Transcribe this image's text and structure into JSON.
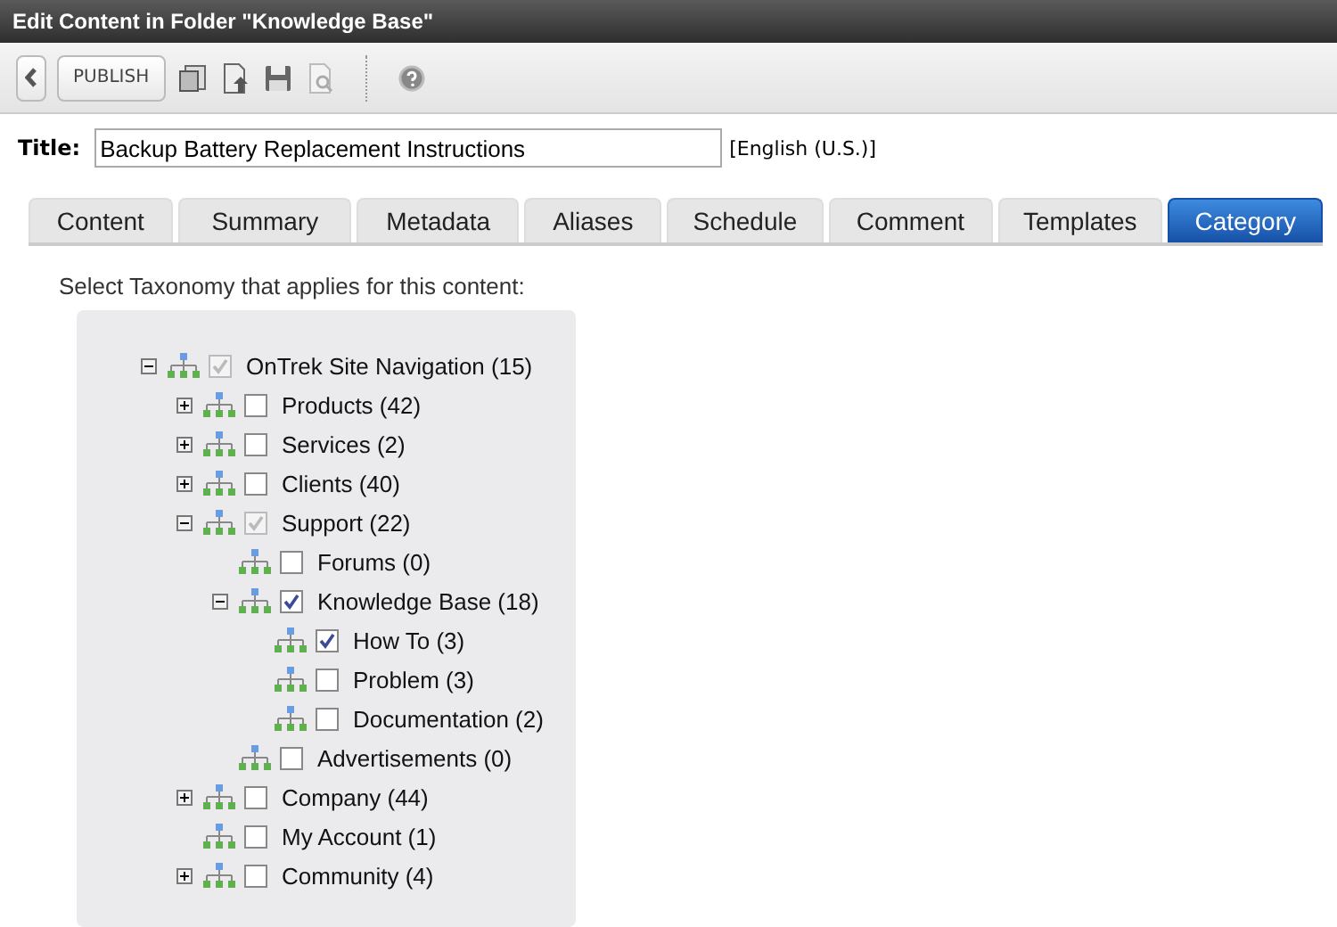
{
  "window": {
    "title": "Edit Content in Folder \"Knowledge Base\""
  },
  "toolbar": {
    "publish": "PUBLISH"
  },
  "title_field": {
    "label": "Title:",
    "value": "Backup Battery Replacement Instructions",
    "language": "[English (U.S.)]"
  },
  "tabs": [
    {
      "label": "Content",
      "selected": false
    },
    {
      "label": "Summary",
      "selected": false
    },
    {
      "label": "Metadata",
      "selected": false
    },
    {
      "label": "Aliases",
      "selected": false
    },
    {
      "label": "Schedule",
      "selected": false
    },
    {
      "label": "Comment",
      "selected": false
    },
    {
      "label": "Templates",
      "selected": false
    },
    {
      "label": "Category",
      "selected": true
    }
  ],
  "taxonomy": {
    "prompt": "Select Taxonomy that applies for this content:",
    "tree": [
      {
        "label": "OnTrek Site Navigation (15)",
        "kind": "branch",
        "expanded": true,
        "checked": true,
        "disabled": true,
        "children": [
          {
            "label": "Products (42)",
            "kind": "branch",
            "expanded": false,
            "checked": false,
            "disabled": false
          },
          {
            "label": "Services (2)",
            "kind": "branch",
            "expanded": false,
            "checked": false,
            "disabled": false
          },
          {
            "label": "Clients (40)",
            "kind": "branch",
            "expanded": false,
            "checked": false,
            "disabled": false
          },
          {
            "label": "Support (22)",
            "kind": "branch",
            "expanded": true,
            "checked": true,
            "disabled": true,
            "children": [
              {
                "label": "Forums (0)",
                "kind": "leaf",
                "checked": false,
                "disabled": false
              },
              {
                "label": "Knowledge Base (18)",
                "kind": "branch",
                "expanded": true,
                "checked": true,
                "disabled": false,
                "children": [
                  {
                    "label": "How To (3)",
                    "kind": "leaf",
                    "checked": true,
                    "disabled": false
                  },
                  {
                    "label": "Problem (3)",
                    "kind": "leaf",
                    "checked": false,
                    "disabled": false
                  },
                  {
                    "label": "Documentation (2)",
                    "kind": "leaf",
                    "checked": false,
                    "disabled": false
                  }
                ]
              },
              {
                "label": "Advertisements (0)",
                "kind": "leaf",
                "checked": false,
                "disabled": false
              }
            ]
          },
          {
            "label": "Company (44)",
            "kind": "branch",
            "expanded": false,
            "checked": false,
            "disabled": false
          },
          {
            "label": "My Account (1)",
            "kind": "leaf",
            "checked": false,
            "disabled": false
          },
          {
            "label": "Community (4)",
            "kind": "branch",
            "expanded": false,
            "checked": false,
            "disabled": false
          }
        ]
      }
    ]
  }
}
